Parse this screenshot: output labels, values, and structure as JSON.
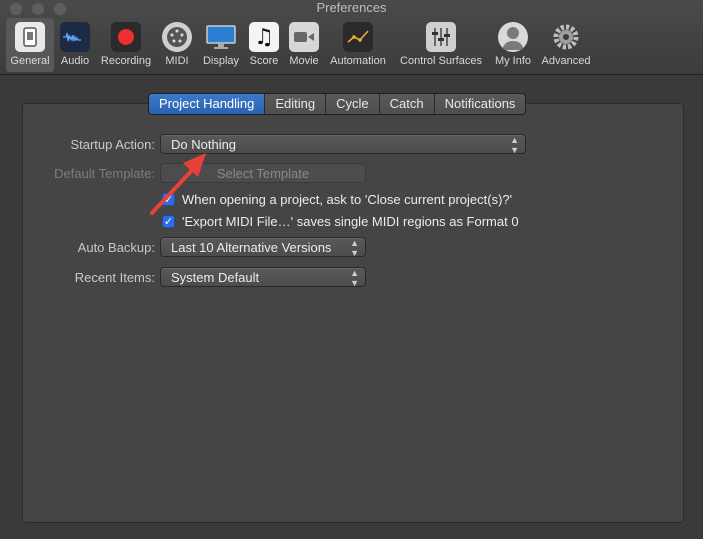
{
  "window": {
    "title": "Preferences"
  },
  "toolbar": {
    "items": [
      {
        "label": "General",
        "icon": "general-icon",
        "active": true
      },
      {
        "label": "Audio",
        "icon": "audio-waveform-icon"
      },
      {
        "label": "Recording",
        "icon": "record-icon"
      },
      {
        "label": "MIDI",
        "icon": "midi-connector-icon"
      },
      {
        "label": "Display",
        "icon": "display-monitor-icon"
      },
      {
        "label": "Score",
        "icon": "music-note-icon"
      },
      {
        "label": "Movie",
        "icon": "movie-camera-icon"
      },
      {
        "label": "Automation",
        "icon": "automation-curve-icon"
      },
      {
        "label": "Control Surfaces",
        "icon": "faders-icon"
      },
      {
        "label": "My Info",
        "icon": "user-avatar-icon"
      },
      {
        "label": "Advanced",
        "icon": "gear-icon"
      }
    ]
  },
  "tabs": [
    {
      "label": "Project Handling",
      "active": true
    },
    {
      "label": "Editing"
    },
    {
      "label": "Cycle"
    },
    {
      "label": "Catch"
    },
    {
      "label": "Notifications"
    }
  ],
  "settings": {
    "startup_action_label": "Startup Action:",
    "startup_action_value": "Do Nothing",
    "default_template_label": "Default Template:",
    "select_template_button": "Select Template",
    "close_project_checkbox": "When opening a project, ask to 'Close current project(s)?'",
    "export_midi_checkbox": "'Export MIDI File…' saves single MIDI regions as Format 0",
    "auto_backup_label": "Auto Backup:",
    "auto_backup_value": "Last 10 Alternative Versions",
    "recent_items_label": "Recent Items:",
    "recent_items_value": "System Default"
  },
  "colors": {
    "accent": "#2f6ee0",
    "annotation_arrow": "#e8413a"
  }
}
